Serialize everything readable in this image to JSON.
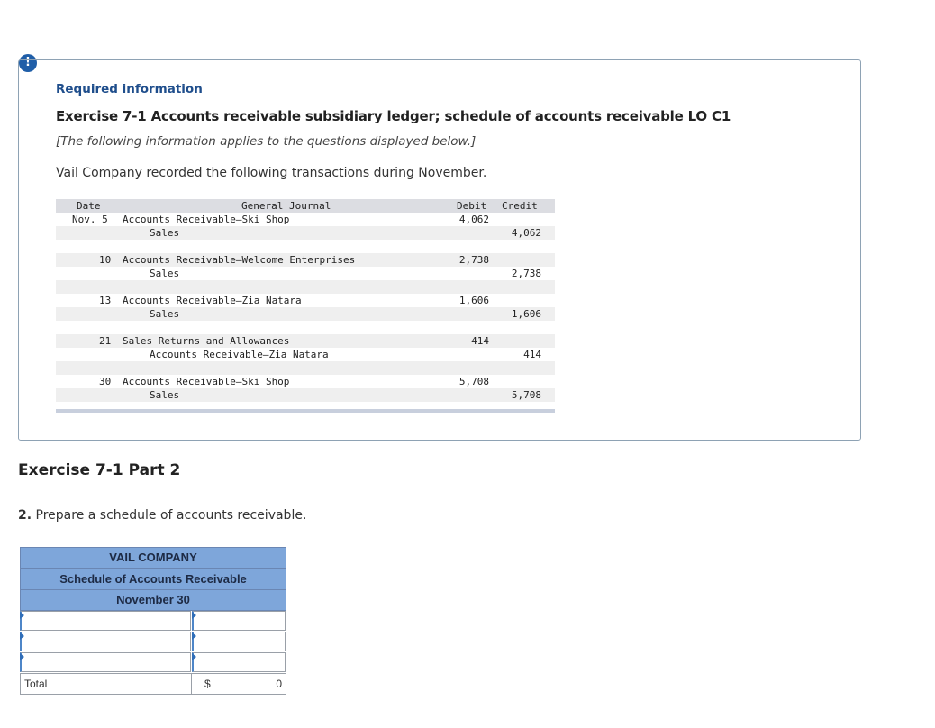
{
  "alert_icon": "!",
  "required_info": "Required information",
  "exercise_title": "Exercise 7-1 Accounts receivable subsidiary ledger; schedule of accounts receivable LO C1",
  "note": "[The following information applies to the questions displayed below.]",
  "intro": "Vail Company recorded the following transactions during November.",
  "journal": {
    "headers": {
      "date": "Date",
      "journal": "General Journal",
      "debit": "Debit",
      "credit": "Credit"
    },
    "rows": [
      {
        "date": "Nov. 5",
        "account": "Accounts Receivable—Ski Shop",
        "debit": "4,062",
        "credit": ""
      },
      {
        "date": "",
        "account": "Sales",
        "debit": "",
        "credit": "4,062"
      },
      {
        "date": "10",
        "account": "Accounts Receivable—Welcome Enterprises",
        "debit": "2,738",
        "credit": ""
      },
      {
        "date": "",
        "account": "Sales",
        "debit": "",
        "credit": "2,738"
      },
      {
        "date": "13",
        "account": "Accounts Receivable—Zia Natara",
        "debit": "1,606",
        "credit": ""
      },
      {
        "date": "",
        "account": "Sales",
        "debit": "",
        "credit": "1,606"
      },
      {
        "date": "21",
        "account": "Sales Returns and Allowances",
        "debit": "414",
        "credit": ""
      },
      {
        "date": "",
        "account": "Accounts Receivable—Zia Natara",
        "debit": "",
        "credit": "414"
      },
      {
        "date": "30",
        "account": "Accounts Receivable—Ski Shop",
        "debit": "5,708",
        "credit": ""
      },
      {
        "date": "",
        "account": "Sales",
        "debit": "",
        "credit": "5,708"
      }
    ]
  },
  "part_title": "Exercise 7-1 Part 2",
  "question_number": "2.",
  "question_text": "Prepare a schedule of accounts receivable.",
  "schedule": {
    "company": "VAIL COMPANY",
    "title": "Schedule of Accounts Receivable",
    "date": "November 30",
    "inputs": [
      {
        "name": "",
        "amount": ""
      },
      {
        "name": "",
        "amount": ""
      },
      {
        "name": "",
        "amount": ""
      }
    ],
    "total_label": "Total",
    "currency": "$",
    "total_value": "0"
  }
}
